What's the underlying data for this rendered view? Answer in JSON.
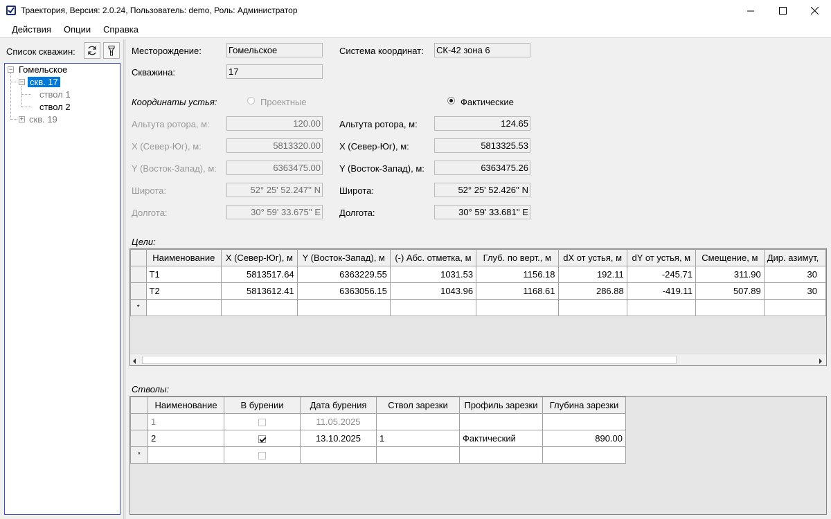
{
  "window": {
    "title": "Траектория, Версия: 2.0.24, Пользователь: demo, Роль: Администратор",
    "controls": [
      "minimize-icon",
      "maximize-icon",
      "close-icon"
    ]
  },
  "menu": [
    "Действия",
    "Опции",
    "Справка"
  ],
  "left": {
    "label": "Список скважин:",
    "tree": {
      "field": "Гомельское",
      "wells": [
        {
          "label": "скв. 17",
          "selected": true,
          "bores": [
            "ствол 1",
            "ствол 2"
          ]
        },
        {
          "label": "скв. 19",
          "selected": false
        }
      ]
    }
  },
  "form": {
    "field_label": "Месторождение:",
    "field_value": "Гомельское",
    "crs_label": "Система координат:",
    "crs_value": "СК-42 зона 6",
    "well_label": "Скважина:",
    "well_value": "17",
    "coords_label": "Координаты устья:",
    "design_radio": "Проектные",
    "actual_radio": "Фактические",
    "design": {
      "alt_label": "Альтута ротора, м:",
      "alt": "120.00",
      "x_label": "X (Север-Юг), м:",
      "x": "5813320.00",
      "y_label": "Y (Восток-Запад), м:",
      "y": "6363475.00",
      "lat_label": "Широта:",
      "lat": "52° 25' 52.247'' N",
      "lon_label": "Долгота:",
      "lon": "30° 59' 33.675'' E"
    },
    "actual": {
      "alt_label": "Альтута ротора, м:",
      "alt": "124.65",
      "x_label": "X (Север-Юг), м:",
      "x": "5813325.53",
      "y_label": "Y (Восток-Запад), м:",
      "y": "6363475.26",
      "lat_label": "Широта:",
      "lat": "52° 25' 52.426'' N",
      "lon_label": "Долгота:",
      "lon": "30° 59' 33.681'' E"
    }
  },
  "targets": {
    "label": "Цели:",
    "columns": [
      "Наименование",
      "X (Север-Юг), м",
      "Y (Восток-Запад), м",
      "(-) Абс. отметка, м",
      "Глуб. по верт., м",
      "dX от устья, м",
      "dY от устья, м",
      "Смещение, м",
      "Дир. азимут, "
    ],
    "rows": [
      [
        "T1",
        "5813517.64",
        "6363229.55",
        "1031.53",
        "1156.18",
        "192.11",
        "-245.71",
        "311.90",
        "30"
      ],
      [
        "T2",
        "5813612.41",
        "6363056.15",
        "1043.96",
        "1168.61",
        "286.88",
        "-419.11",
        "507.89",
        "30"
      ]
    ],
    "new_row_marker": "*"
  },
  "bores": {
    "label": "Стволы:",
    "columns": [
      "Наименование",
      "В бурении",
      "Дата бурения",
      "Ствол зарезки",
      "Профиль зарезки",
      "Глубина зарезки"
    ],
    "rows": [
      {
        "name": "1",
        "drilling": false,
        "date": "11.05.2025",
        "from": "",
        "profile": "",
        "depth": ""
      },
      {
        "name": "2",
        "drilling": true,
        "date": "13.10.2025",
        "from": "1",
        "profile": "Фактический",
        "depth": "890.00"
      }
    ],
    "new_row_marker": "*"
  }
}
